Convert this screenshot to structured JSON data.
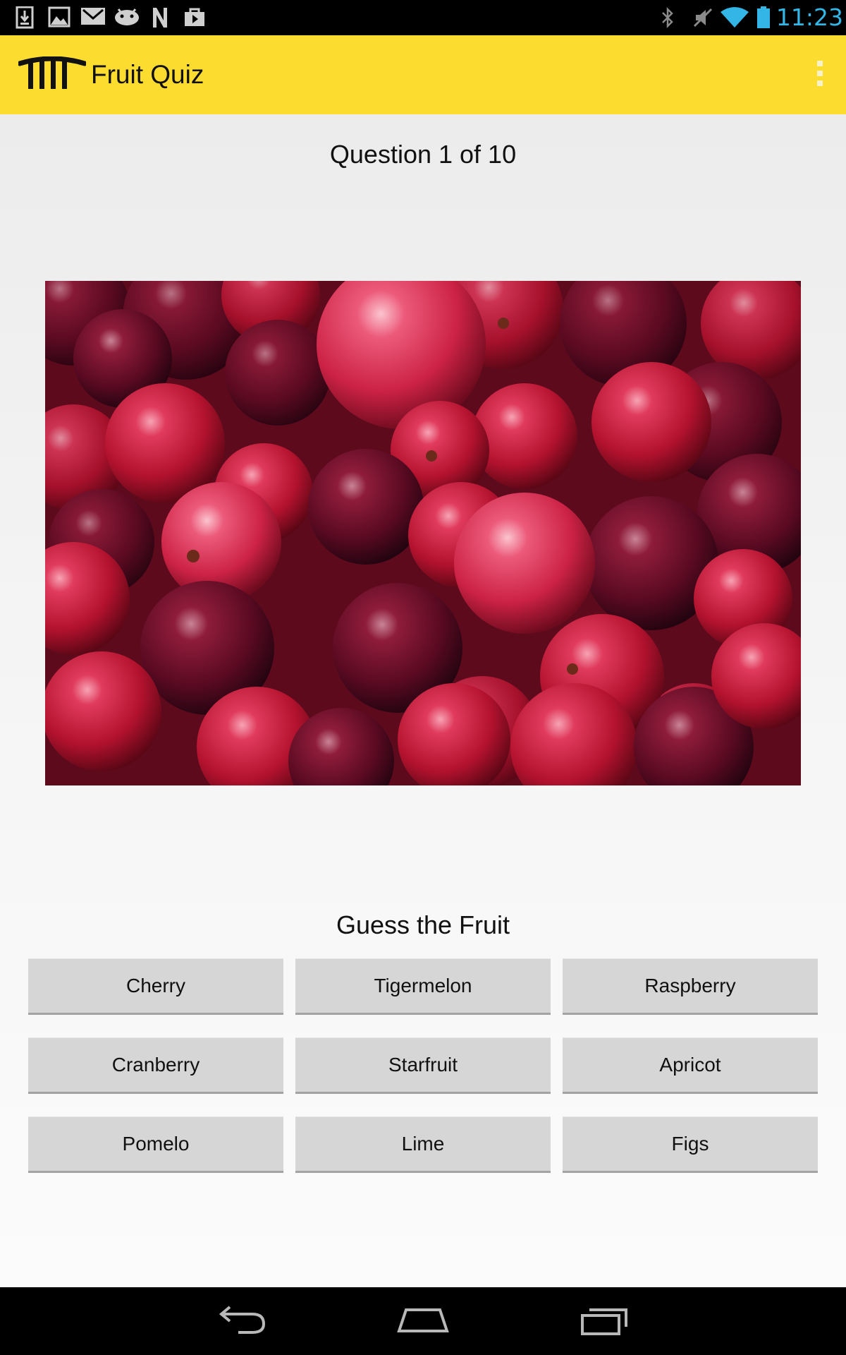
{
  "status_bar": {
    "time": "11:23",
    "notification_icons": [
      "download-icon",
      "gallery-icon",
      "gmail-icon",
      "android-icon",
      "n-app-icon",
      "play-store-icon"
    ],
    "system_icons": [
      "bluetooth-icon",
      "muted-icon",
      "wifi-icon",
      "battery-icon"
    ],
    "clock_color": "#33b5e5"
  },
  "action_bar": {
    "title": "Fruit Quiz",
    "logo_icon": "comb-logo-icon",
    "menu_icon": "overflow-menu-icon",
    "background_color": "#fddc30"
  },
  "quiz": {
    "question_counter": "Question 1 of 10",
    "image_subject": "fruit-photo",
    "guess_label": "Guess the Fruit",
    "answers": [
      {
        "label": "Cherry"
      },
      {
        "label": "Tigermelon"
      },
      {
        "label": "Raspberry"
      },
      {
        "label": "Cranberry"
      },
      {
        "label": "Starfruit"
      },
      {
        "label": "Apricot"
      },
      {
        "label": "Pomelo"
      },
      {
        "label": "Lime"
      },
      {
        "label": "Figs"
      }
    ]
  },
  "nav_bar": {
    "buttons": [
      "back-icon",
      "home-icon",
      "recents-icon"
    ]
  }
}
